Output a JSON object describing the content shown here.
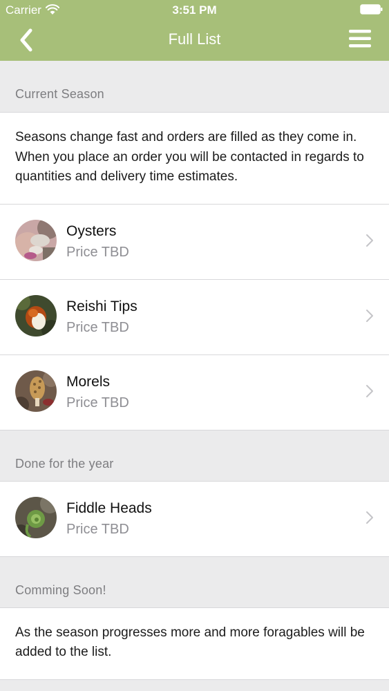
{
  "status_bar": {
    "carrier": "Carrier",
    "time": "3:51 PM"
  },
  "nav": {
    "title": "Full List",
    "back_icon": "chevron-left-icon",
    "menu_icon": "hamburger-menu-icon"
  },
  "colors": {
    "header_bg": "#a7bf79",
    "page_bg": "#ebebec"
  },
  "sections": [
    {
      "header": "Current Season",
      "info": "Seasons change fast and orders are filled as they come in. When you place an order you will be contacted in regards to quantities and delivery time estimates.",
      "items": [
        {
          "title": "Oysters",
          "subtitle": "Price TBD"
        },
        {
          "title": "Reishi Tips",
          "subtitle": "Price TBD"
        },
        {
          "title": "Morels",
          "subtitle": "Price TBD"
        }
      ]
    },
    {
      "header": "Done for the year",
      "items": [
        {
          "title": "Fiddle Heads",
          "subtitle": "Price TBD"
        }
      ]
    },
    {
      "header": "Comming Soon!",
      "info": "As the season progresses more and more foragables will be added to the list."
    }
  ]
}
